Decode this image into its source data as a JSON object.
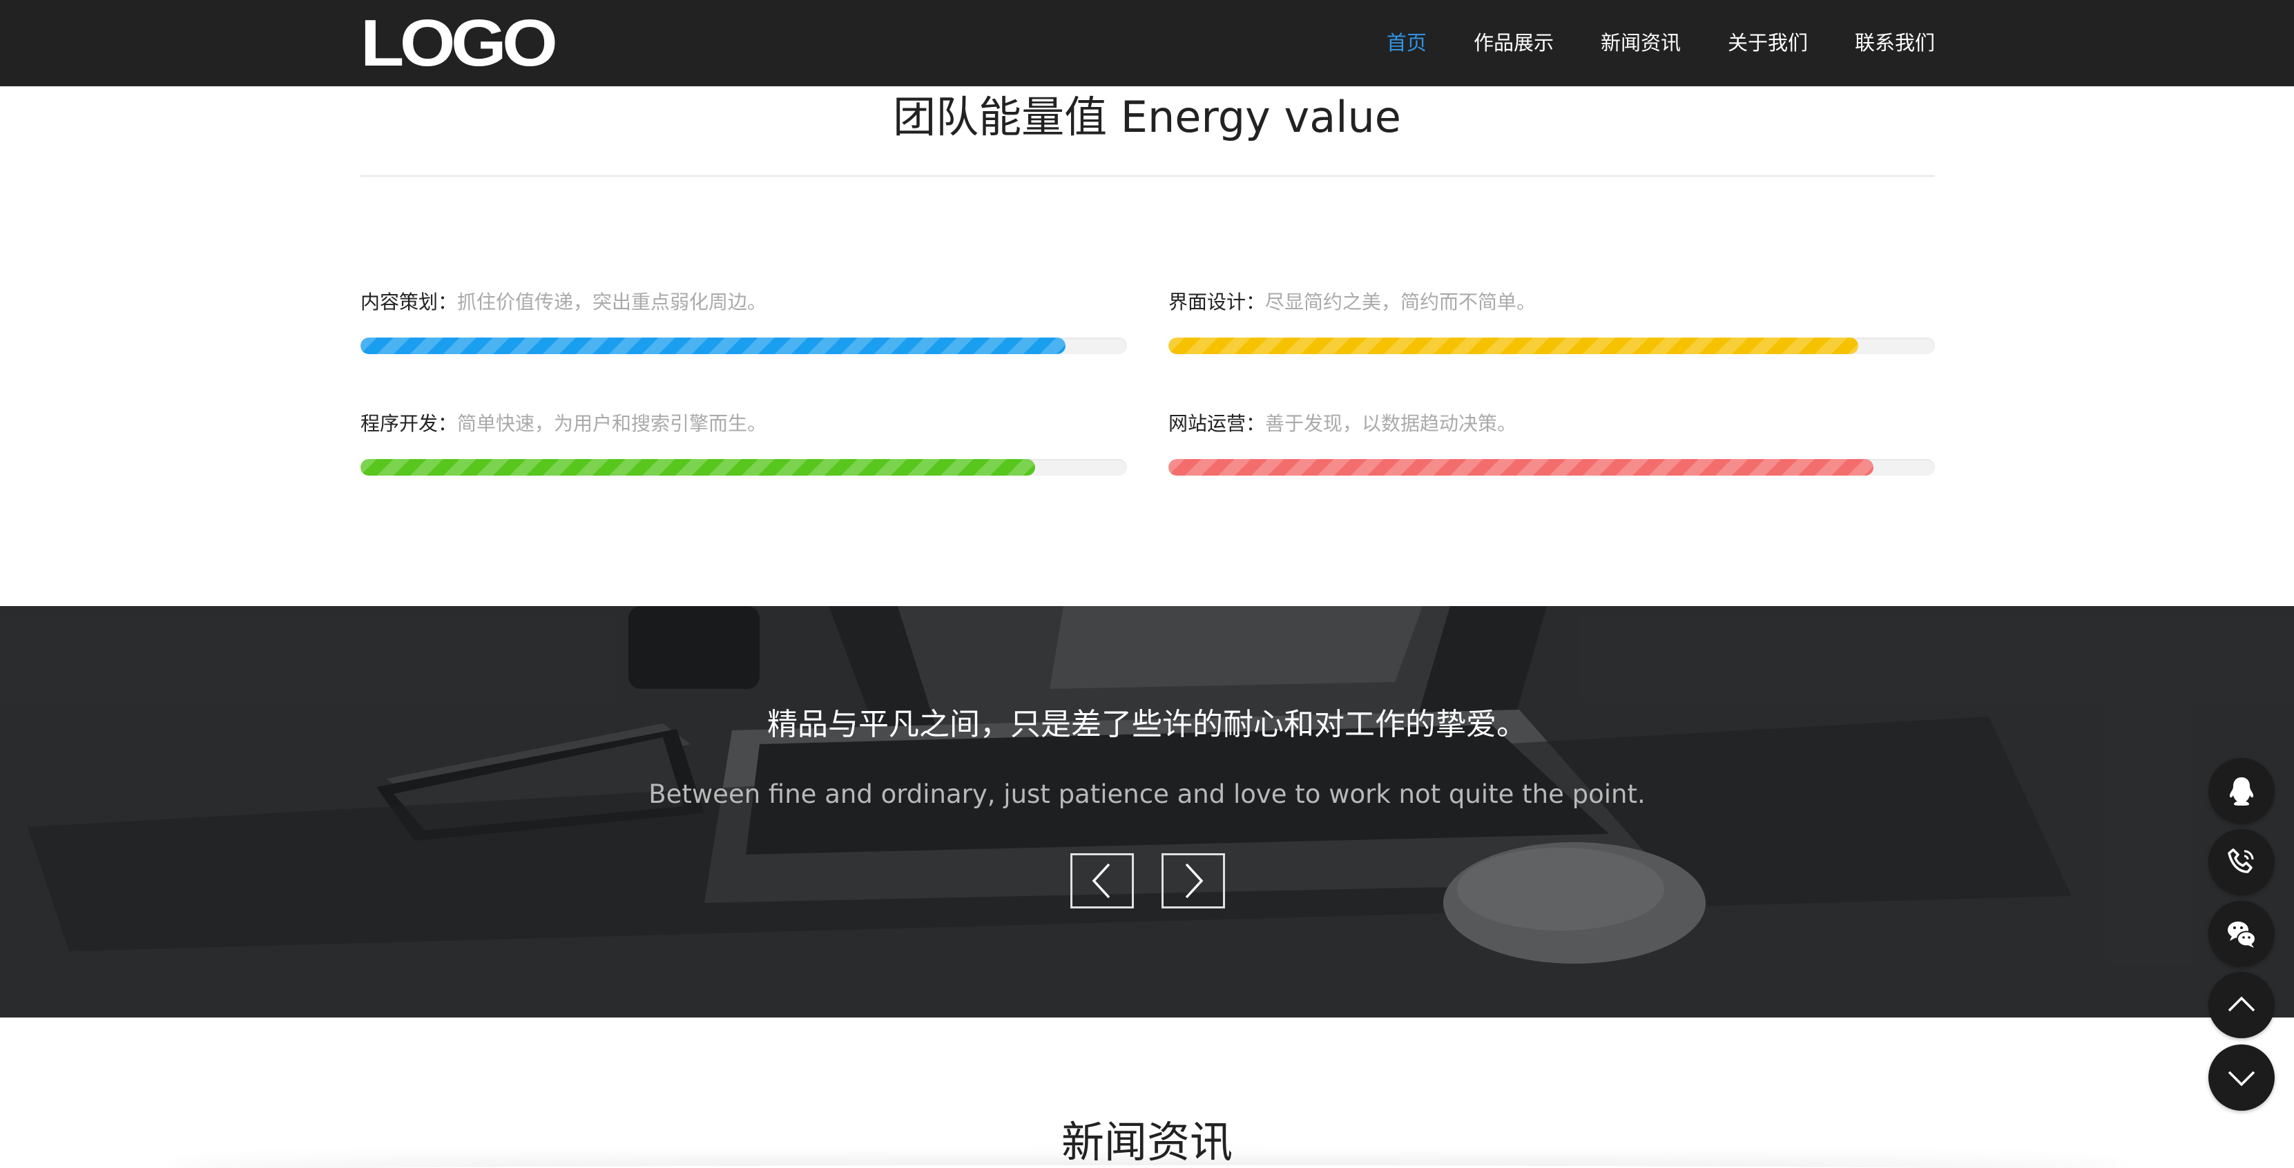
{
  "header": {
    "logo": "LOGO",
    "nav": [
      {
        "label": "首页",
        "active": true
      },
      {
        "label": "作品展示",
        "active": false
      },
      {
        "label": "新闻资讯",
        "active": false
      },
      {
        "label": "关于我们",
        "active": false
      },
      {
        "label": "联系我们",
        "active": false
      }
    ]
  },
  "energy": {
    "title": "团队能量值 Energy value",
    "skills": [
      {
        "name": "内容策划：",
        "desc": "抓住价值传递，突出重点弱化周边。",
        "percent": 92,
        "color": "#1a9ef0"
      },
      {
        "name": "界面设计：",
        "desc": "尽显简约之美，简约而不简单。",
        "percent": 90,
        "color": "#f6c200"
      },
      {
        "name": "程序开发：",
        "desc": "简单快速，为用户和搜索引擎而生。",
        "percent": 88,
        "color": "#57c61d"
      },
      {
        "name": "网站运营：",
        "desc": "善于发现，以数据趋动决策。",
        "percent": 92,
        "color": "#f46d6d"
      }
    ]
  },
  "banner": {
    "title": "精品与平凡之间，只是差了些许的耐心和对工作的挚爱。",
    "subtitle": "Between fine and ordinary, just patience and love to work not quite the point.",
    "prev_icon": "chevron-left-icon",
    "next_icon": "chevron-right-icon"
  },
  "news": {
    "title": "新闻资讯"
  },
  "floating": {
    "buttons": [
      "qq-icon",
      "phone-icon",
      "wechat-icon",
      "chevron-up-icon",
      "chevron-down-icon"
    ]
  }
}
